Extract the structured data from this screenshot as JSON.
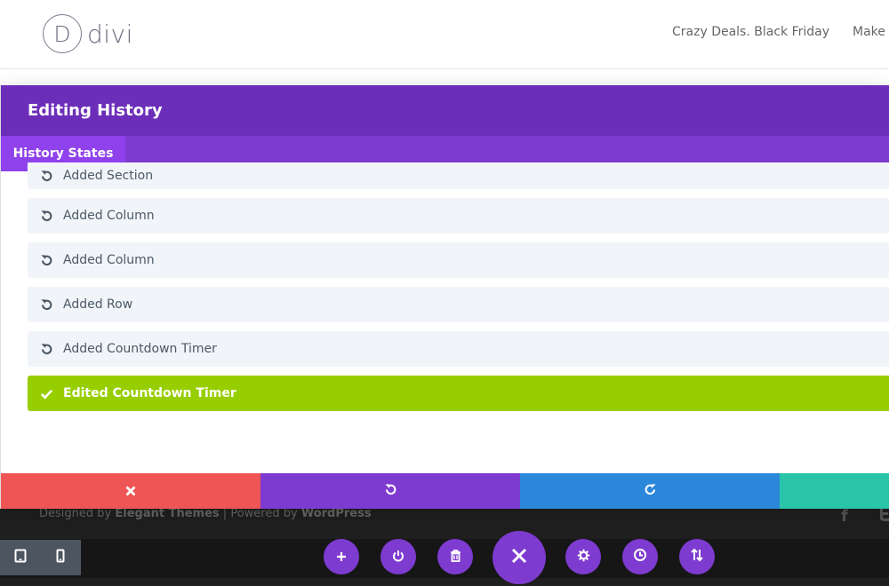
{
  "site": {
    "logo_letter": "D",
    "logo_text": "divi",
    "nav": [
      "Crazy Deals. Black Friday",
      "Make M"
    ]
  },
  "modal": {
    "title": "Editing History",
    "tab": "History States",
    "history": [
      {
        "label": "Added Section",
        "icon": "undo-icon",
        "active": false
      },
      {
        "label": "Added Column",
        "icon": "undo-icon",
        "active": false
      },
      {
        "label": "Added Column",
        "icon": "undo-icon",
        "active": false
      },
      {
        "label": "Added Row",
        "icon": "undo-icon",
        "active": false
      },
      {
        "label": "Added Countdown Timer",
        "icon": "undo-icon",
        "active": false
      },
      {
        "label": "Edited Countdown Timer",
        "icon": "check-icon",
        "active": true
      }
    ],
    "footer_buttons": [
      "close-icon",
      "undo-icon",
      "redo-icon",
      "save"
    ]
  },
  "footer": {
    "designed_by": "Designed by",
    "elegant": "Elegant Themes",
    "separator": "|",
    "powered_by": "Powered by",
    "wordpress": "WordPress"
  },
  "builder_bar": {
    "buttons": [
      "plus-icon",
      "power-icon",
      "trash-icon",
      "close-icon",
      "gear-icon",
      "clock-icon",
      "sort-icon"
    ],
    "view_modes": [
      "tablet-icon",
      "phone-icon"
    ]
  },
  "colors": {
    "purple_dark": "#6c2eb9",
    "purple": "#7e3bd0",
    "active_green": "#97ce00",
    "red": "#ef5555",
    "blue": "#2b87da",
    "teal": "#29c4a9"
  }
}
